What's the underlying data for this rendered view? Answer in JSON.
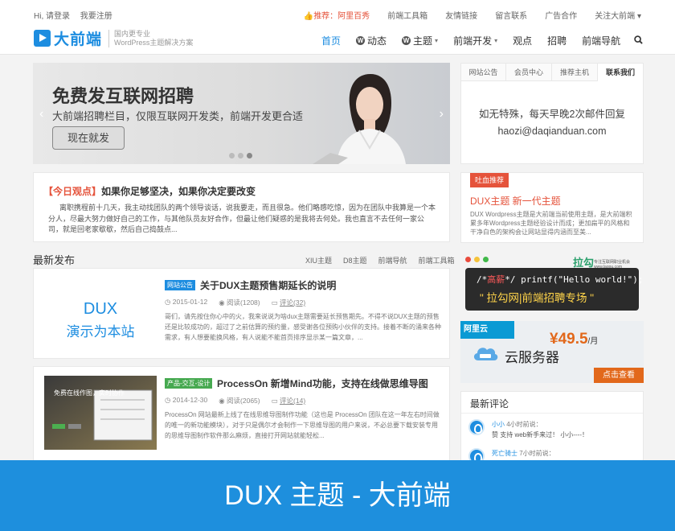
{
  "topbar": {
    "left": [
      "Hi, 请登录",
      "我要注册"
    ],
    "recommend": "推荐：阿里百秀",
    "links": [
      "前端工具箱",
      "友情链接",
      "留言联系",
      "广告合作",
      "关注大前端 ▾"
    ]
  },
  "header": {
    "logo": "大前端",
    "logo_sub1": "国内更专业",
    "logo_sub2": "WordPress主题解决方案",
    "nav": [
      {
        "label": "首页",
        "active": true,
        "wp": false,
        "caret": false
      },
      {
        "label": "动态",
        "active": false,
        "wp": true,
        "caret": false
      },
      {
        "label": "主题",
        "active": false,
        "wp": true,
        "caret": true
      },
      {
        "label": "前端开发",
        "active": false,
        "wp": false,
        "caret": true
      },
      {
        "label": "观点",
        "active": false,
        "wp": false,
        "caret": false
      },
      {
        "label": "招聘",
        "active": false,
        "wp": false,
        "caret": false
      },
      {
        "label": "前端导航",
        "active": false,
        "wp": false,
        "caret": false
      }
    ]
  },
  "slider": {
    "title": "免费发互联网招聘",
    "subtitle": "大前端招聘栏目，仅限互联网开发类，前端开发更合适",
    "button": "现在就发",
    "prev": "‹",
    "next": "›"
  },
  "today": {
    "tag": "【今日观点】",
    "title": "如果你足够坚决，如果你决定要改变",
    "text": "离职携程前十几天，我主动找团队的两个领导谈话，说我要走，而且很急。他们略感吃惊，因为在团队中我算是一个本分人，尽最大努力做好自己的工作，与其他队员友好合作，但最让他们疑惑的是我将去何处。我也直言不去任何一家公司，就是回老家歇歇，然后自己捣鼓点..."
  },
  "latest": {
    "heading": "最新发布",
    "links": [
      "XIU主题",
      "D8主题",
      "前端导航",
      "前端工具箱"
    ]
  },
  "posts": [
    {
      "thumb_line1": "DUX",
      "thumb_line2": "演示为本站",
      "cat": "网站公告",
      "title": "关于DUX主题预售期延长的说明",
      "date": "2015-01-12",
      "views": "阅读(1208)",
      "comments": "评论(32)",
      "excerpt": "哥们，请先按住你心中的火，我来说说为啥dux主题需要延长预售期先。不得不说DUX主题的预售还是比较成功的，超过了之前估算的预约量，感受谢各位预购小伙伴的支持。接着不断的涌来各种需求，有人想要能换风格，有人说能不能首页排序显示某一篇文章，..."
    },
    {
      "thumb_caption": "免费在线作图，实时协作",
      "cat": "产品-交互-设计",
      "title": "ProcessOn 新增Mind功能，支持在线做思维导图",
      "date": "2014-12-30",
      "views": "阅读(2065)",
      "comments": "评论(14)",
      "excerpt": "ProcessOn 网站最新上线了在线思维导图制作功能（这也是 ProcessOn 团队在这一年左右时间做的唯一的新功能模块），对于只是偶尔才会制作一下思维导图的用户来说，不必总要下载安装专用的思维导图制作软件那么麻烦，直接打开网站就能轻松..."
    }
  ],
  "sidebar": {
    "tabs": [
      "网站公告",
      "会员中心",
      "推荐主机",
      "联系我们"
    ],
    "active_tab": 3,
    "contact_line1": "如无特殊，每天早晚2次邮件回复",
    "contact_line2": "haozi@daqianduan.com",
    "hot_badge": "吐血推荐",
    "hot_title": "DUX主题 新一代主题",
    "hot_desc": "DUX Wordpress主题是大前端当前使用主题，是大前端积累多年Wordpress主题经验设计而成；更加扁平的风格和干净白色的架构会让网站显得内涵而至美...",
    "lagou_code_prefix": "/*",
    "lagou_code_hi": "高薪",
    "lagou_code_rest": "*/ printf(\"Hello world!\");",
    "lagou_slogan": "\" 拉勾网|前端招聘专场 \"",
    "lagou_brand": "拉勾",
    "lagou_brand_sub": "专注互联网职业机会 www.lagou.com",
    "aliyun_logo": "阿里云",
    "aliyun_price": "¥49.5",
    "aliyun_unit": "/月",
    "aliyun_service": "云服务器",
    "aliyun_button": "点击查看",
    "comments_heading": "最新评论",
    "comments": [
      {
        "name": "小小",
        "time": "4小时前说：",
        "text": "赞 支持 web新手来过！ 小小----！"
      },
      {
        "name": "死亡骑士",
        "time": "7小时前说：",
        "text": ""
      }
    ]
  },
  "banner": "DUX 主题 - 大前端",
  "colors": {
    "accent": "#1d8de0",
    "red": "#e5533b",
    "orange": "#e2681b",
    "banner": "#1e8fdd"
  }
}
